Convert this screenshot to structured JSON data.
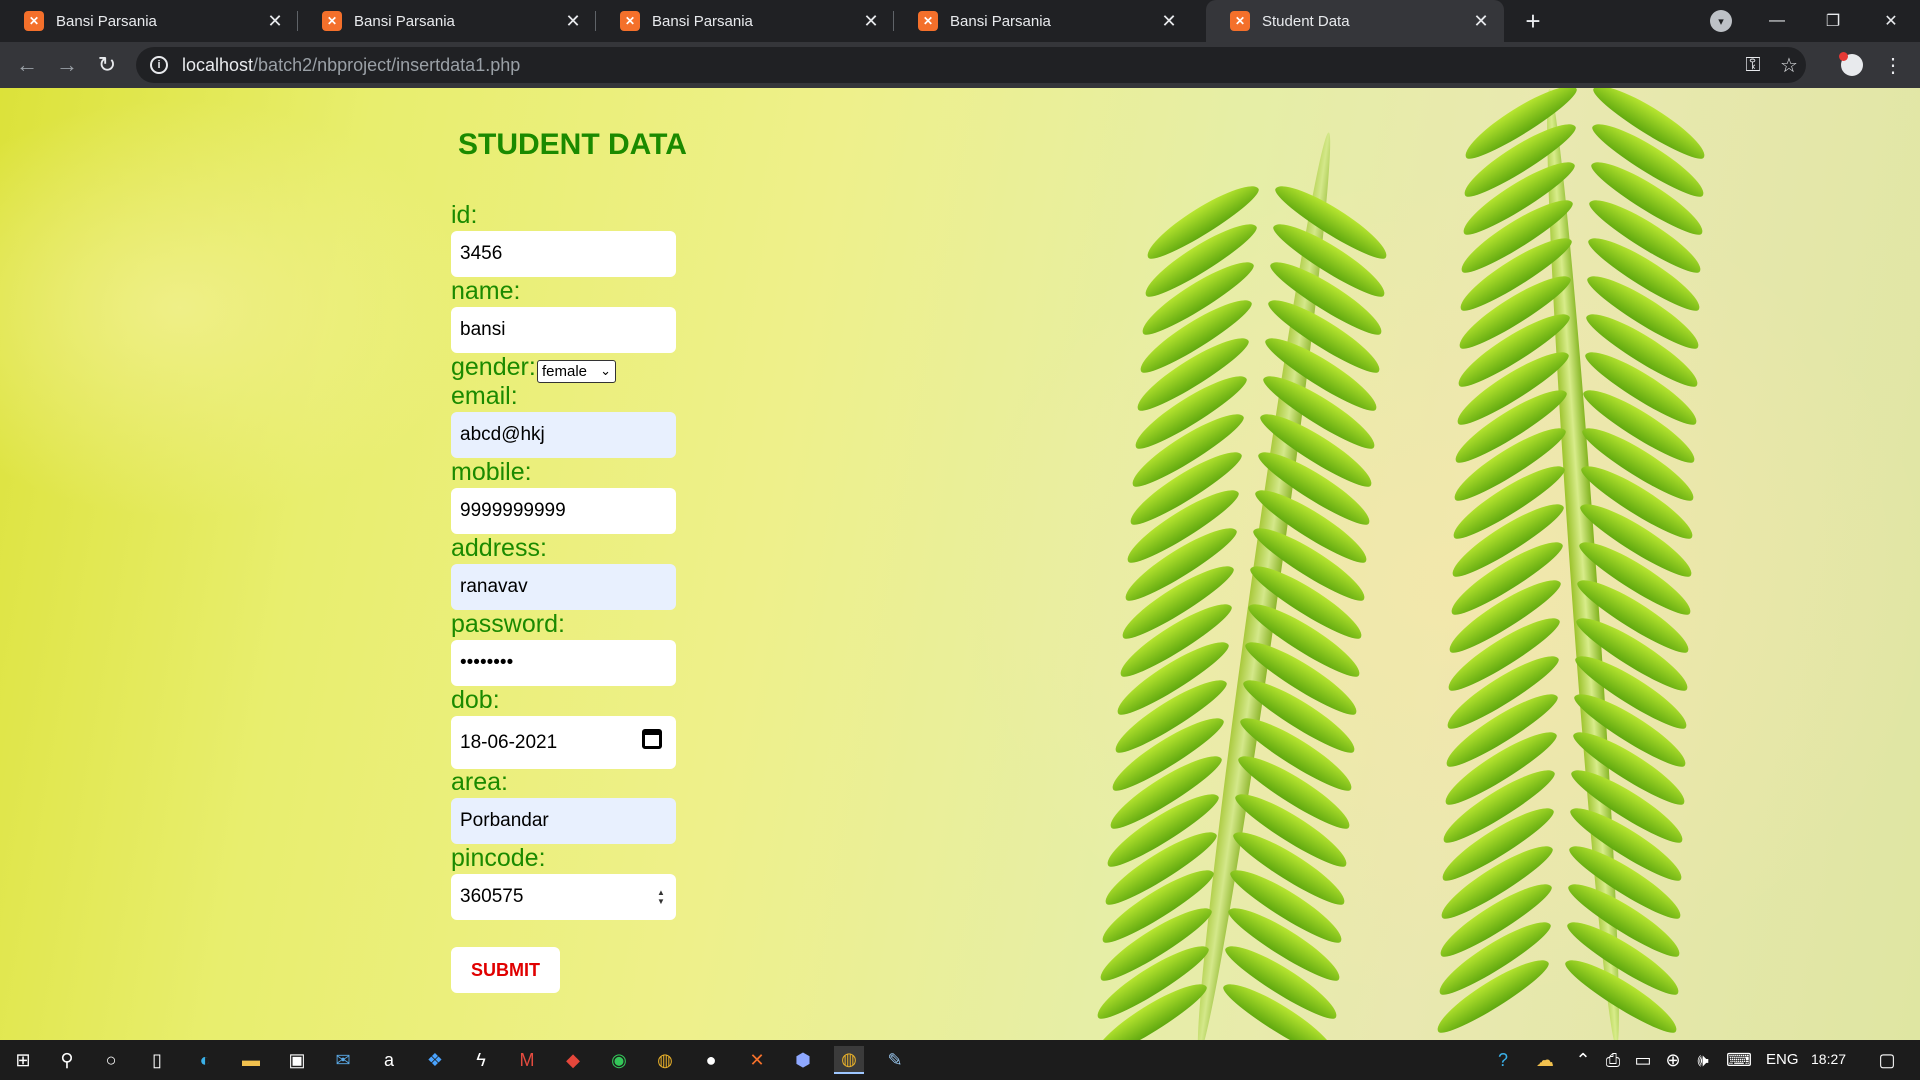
{
  "browser": {
    "tabs": [
      {
        "title": "Bansi Parsania",
        "active": false
      },
      {
        "title": "Bansi Parsania",
        "active": false
      },
      {
        "title": "Bansi Parsania",
        "active": false
      },
      {
        "title": "Bansi Parsania",
        "active": false
      },
      {
        "title": "Student Data",
        "active": true
      }
    ],
    "url_host": "localhost",
    "url_path": "/batch2/nbproject/insertdata1.php"
  },
  "form": {
    "heading": "STUDENT DATA",
    "id_label": "id:",
    "id_value": "3456",
    "name_label": "name:",
    "name_value": "bansi",
    "gender_label": "gender:",
    "gender_value": "female",
    "email_label": "email:",
    "email_value": "abcd@hkj",
    "mobile_label": "mobile:",
    "mobile_value": "9999999999",
    "address_label": "address:",
    "address_value": "ranavav",
    "password_label": "password:",
    "password_value": "••••••••",
    "dob_label": "dob:",
    "dob_value": "18-06-2021",
    "area_label": "area:",
    "area_value": "Porbandar",
    "pincode_label": "pincode:",
    "pincode_value": "360575",
    "submit_label": "SUBMIT"
  },
  "taskbar": {
    "language": "ENG",
    "time": "18:27"
  },
  "colors": {
    "label_green": "#1b8a00",
    "submit_red": "#e00000",
    "autofill_blue": "#e8f0fe"
  }
}
